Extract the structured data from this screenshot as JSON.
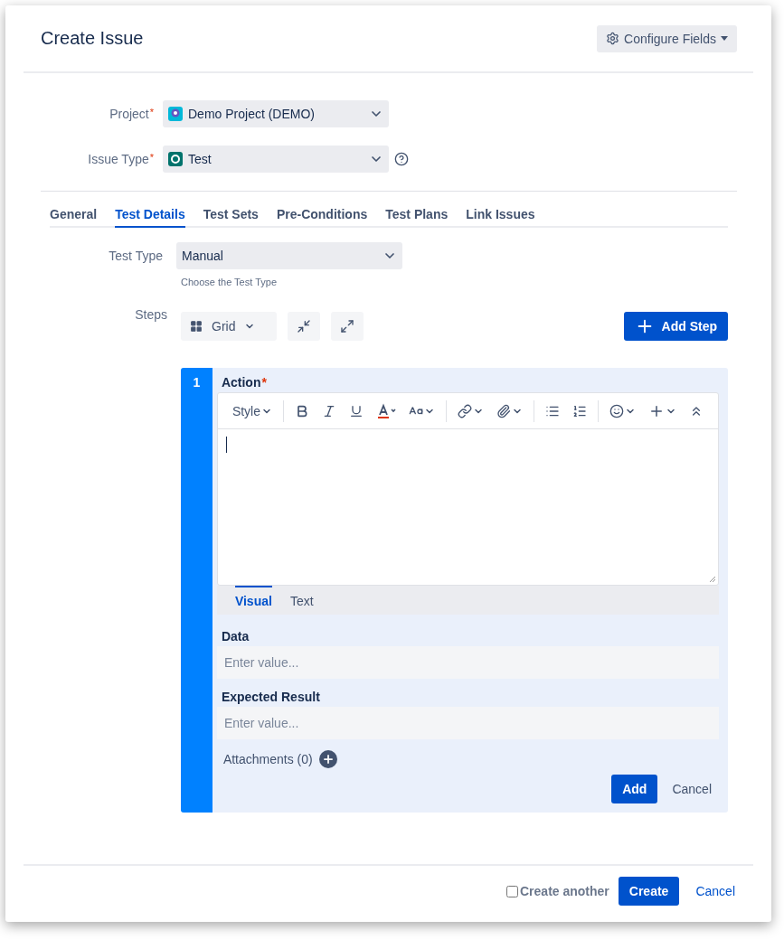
{
  "dialog": {
    "title": "Create Issue",
    "configure_button": "Configure Fields"
  },
  "fields": [
    {
      "label": "Project",
      "required_mark": "*",
      "value": "Demo Project (DEMO)",
      "kind": "project",
      "help": false
    },
    {
      "label": "Issue Type",
      "required_mark": "*",
      "value": "Test",
      "kind": "issuetype",
      "help": true
    }
  ],
  "tabs": [
    {
      "label": "General",
      "selected": false
    },
    {
      "label": "Test Details",
      "selected": true
    },
    {
      "label": "Test Sets",
      "selected": false
    },
    {
      "label": "Pre-Conditions",
      "selected": false
    },
    {
      "label": "Test Plans",
      "selected": false
    },
    {
      "label": "Link Issues",
      "selected": false
    }
  ],
  "test_type": {
    "label": "Test Type",
    "value": "Manual",
    "hint": "Choose the Test Type"
  },
  "steps": {
    "label": "Steps",
    "view": "Grid",
    "add_button": "Add Step",
    "step": {
      "number": "1",
      "action_label": "Action",
      "action_required_mark": "*",
      "style": "Style",
      "editor_tabs": [
        {
          "label": "Visual",
          "selected": true
        },
        {
          "label": "Text",
          "selected": false
        }
      ],
      "data": {
        "label": "Data",
        "placeholder": "Enter value..."
      },
      "expected": {
        "label": "Expected Result",
        "placeholder": "Enter value..."
      },
      "attachments": "Attachments (0)",
      "add": "Add",
      "cancel": "Cancel"
    }
  },
  "footer": {
    "create_another": {
      "label": "Create another",
      "checked": false
    },
    "create": "Create",
    "cancel": "Cancel"
  }
}
